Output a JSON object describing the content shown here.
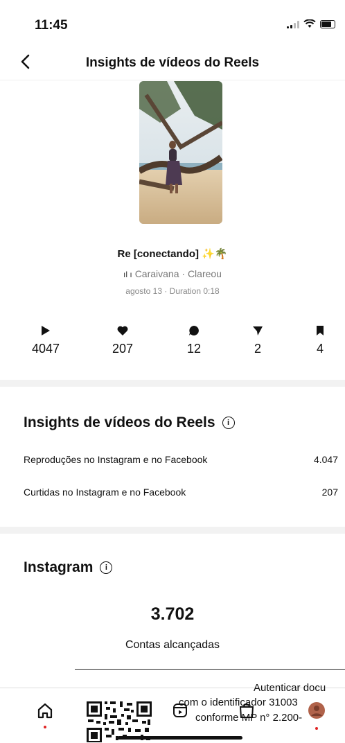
{
  "status_bar": {
    "time": "11:45"
  },
  "nav": {
    "title": "Insights de vídeos do Reels"
  },
  "reel": {
    "title": "Re [conectando] ✨🌴",
    "audio": "Caraivana · Clareou",
    "meta": "agosto 13 · Duration 0:18"
  },
  "stats": [
    {
      "icon": "play-icon",
      "value": "4047"
    },
    {
      "icon": "heart-icon",
      "value": "207"
    },
    {
      "icon": "comment-icon",
      "value": "12"
    },
    {
      "icon": "share-icon",
      "value": "2"
    },
    {
      "icon": "bookmark-icon",
      "value": "4"
    }
  ],
  "insights": {
    "title": "Insights de vídeos do Reels",
    "rows": [
      {
        "label": "Reproduções no Instagram e no Facebook",
        "value": "4.047"
      },
      {
        "label": "Curtidas no Instagram e no Facebook",
        "value": "207"
      }
    ]
  },
  "instagram": {
    "title": "Instagram",
    "reach_value": "3.702",
    "reach_label": "Contas alcançadas"
  },
  "tabs": [
    {
      "icon": "home-icon"
    },
    {
      "icon": "reels-icon"
    },
    {
      "icon": "shop-icon"
    },
    {
      "icon": "profile-avatar-icon"
    }
  ],
  "stamp": {
    "line1": "Autenticar docu",
    "line2": "com o identificador 31003",
    "line3": "conforme MP n° 2.200-"
  },
  "colors": {
    "accent_dot": "#e02424",
    "divider": "#f2f2f2",
    "muted_text": "#777777"
  }
}
